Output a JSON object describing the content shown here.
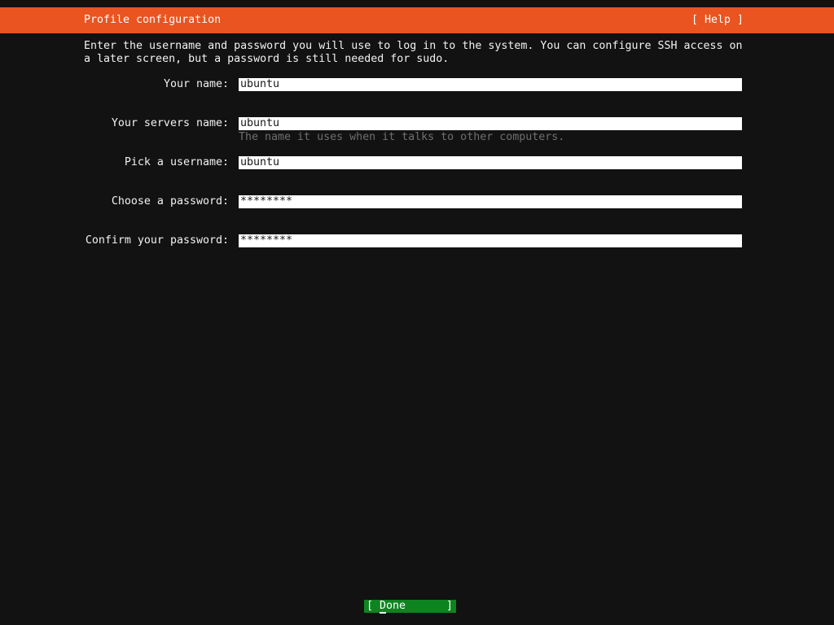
{
  "header": {
    "title": "Profile configuration",
    "help_label": "[ Help ]"
  },
  "intro": {
    "line1": "Enter the username and password you will use to log in to the system. You can configure SSH access on",
    "line2": "a later screen, but a password is still needed for sudo."
  },
  "form": {
    "fields": [
      {
        "label": "Your name:",
        "value": "ubuntu",
        "type": "text"
      },
      {
        "label": "Your servers name:",
        "value": "ubuntu",
        "type": "text",
        "help": "The name it uses when it talks to other computers."
      },
      {
        "label": "Pick a username:",
        "value": "ubuntu",
        "type": "text"
      },
      {
        "label": "Choose a password:",
        "value": "********",
        "type": "password"
      },
      {
        "label": "Confirm your password:",
        "value": "********",
        "type": "password"
      }
    ]
  },
  "footer": {
    "open_bracket": "[",
    "done_first": "D",
    "done_rest": "one",
    "close_bracket": "]"
  },
  "colors": {
    "accent_orange": "#e95420",
    "button_green": "#0e8420",
    "background": "#121212",
    "field_background": "#ffffff",
    "helper_gray": "#6f6f6f"
  }
}
